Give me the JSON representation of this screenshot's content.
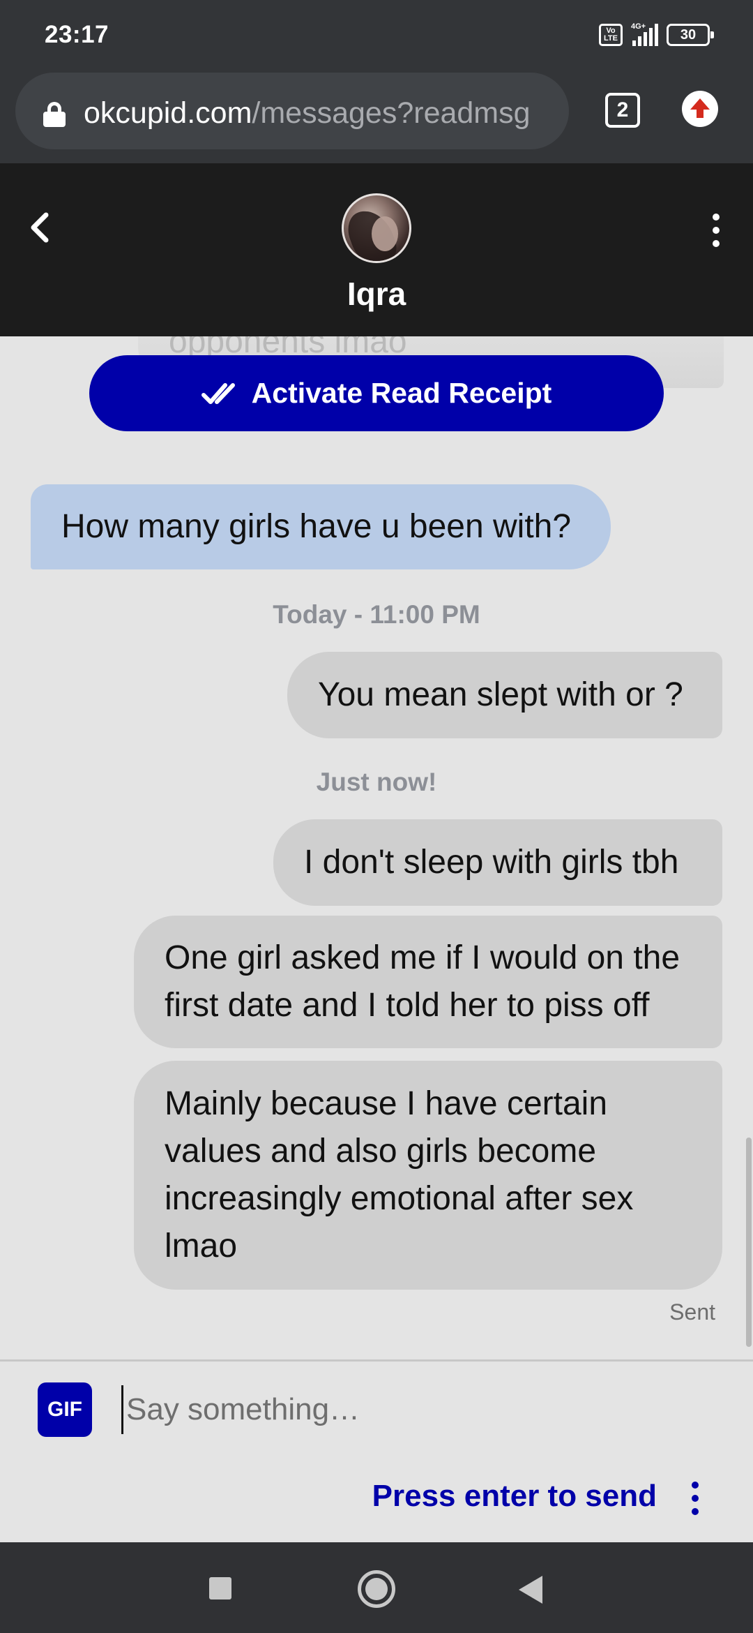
{
  "status_bar": {
    "time": "23:17",
    "volte_label": "Vo LTE",
    "network_label": "4G+",
    "battery_level": "30"
  },
  "browser": {
    "url_domain": "okcupid.com",
    "url_path": "/messages?readmsg",
    "tab_count": "2"
  },
  "chat_header": {
    "contact_name": "Iqra"
  },
  "read_receipt": {
    "label": "Activate Read Receipt"
  },
  "messages": [
    {
      "direction": "received",
      "text": "opponents lmao"
    },
    {
      "direction": "received",
      "text": "How many girls have u been with?"
    },
    {
      "direction": "sent",
      "text": "You mean slept with or ?"
    },
    {
      "direction": "sent",
      "text": "I don't sleep with girls tbh"
    },
    {
      "direction": "sent",
      "text": "One girl asked me if I would on the first date and I told her to piss off"
    },
    {
      "direction": "sent",
      "text": "Mainly because I have certain values and also girls become increasingly emotional after sex lmao"
    }
  ],
  "timestamps": [
    "Today - 11:00 PM",
    "Just now!"
  ],
  "sent_status": "Sent",
  "composer": {
    "gif_label": "GIF",
    "placeholder": "Say something…",
    "send_hint": "Press enter to send"
  },
  "colors": {
    "accent": "#0000a9",
    "received_bubble": "#b8cbe6",
    "sent_bubble": "#cfcfcf",
    "header_bg": "#1c1c1c",
    "browser_bg": "#333538"
  }
}
